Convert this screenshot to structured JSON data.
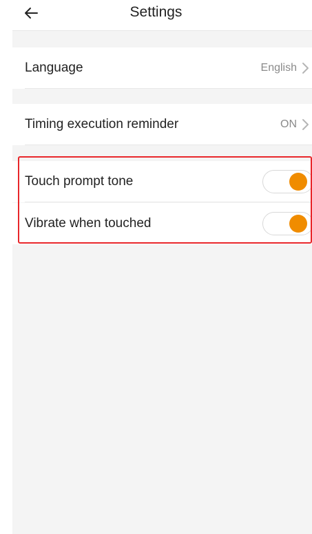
{
  "header": {
    "title": "Settings",
    "back_icon": "back-arrow-icon"
  },
  "settings": {
    "language": {
      "label": "Language",
      "value": "English"
    },
    "timing_reminder": {
      "label": "Timing execution reminder",
      "value": "ON"
    },
    "touch_tone": {
      "label": "Touch prompt tone",
      "enabled": true
    },
    "vibrate": {
      "label": "Vibrate when touched",
      "enabled": true
    }
  },
  "colors": {
    "accent": "#f08c00",
    "highlight": "#e8262a",
    "background": "#f4f4f4"
  }
}
